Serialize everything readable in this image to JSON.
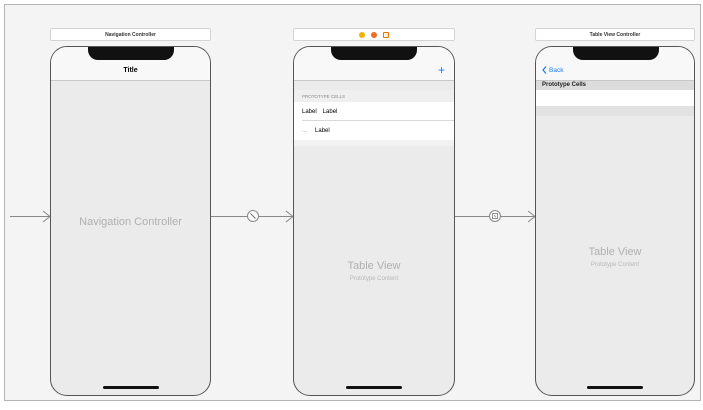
{
  "storyboard": {
    "navigation_scene": {
      "scene_title": "Navigation Controller",
      "nav_title": "Title",
      "controller_label": "Navigation Controller"
    },
    "root_scene": {
      "add_button": "+",
      "section_header": "PROTOTYPE CELLS",
      "cell_1_title": "Label",
      "cell_1_detail": "Label",
      "cell_2_accessory": "...",
      "cell_2_label": "Label",
      "table_label": "Table View",
      "table_sub": "Prototype Content"
    },
    "table_scene": {
      "scene_title": "Table View Controller",
      "back_label": "Back",
      "section_header": "Prototype Cells",
      "table_label": "Table View",
      "table_sub": "Prototype Content"
    }
  },
  "icons": {
    "dock": [
      "view-controller-icon",
      "first-responder-icon",
      "exit-icon"
    ],
    "segue_1": "relationship-segue-icon",
    "segue_2": "show-segue-icon"
  },
  "colors": {
    "accent": "#1a7cf5",
    "canvas": "#f4f4f4",
    "dock_vc": "#f0b400",
    "dock_fr": "#f06a28",
    "dock_exit": "#e07500"
  }
}
